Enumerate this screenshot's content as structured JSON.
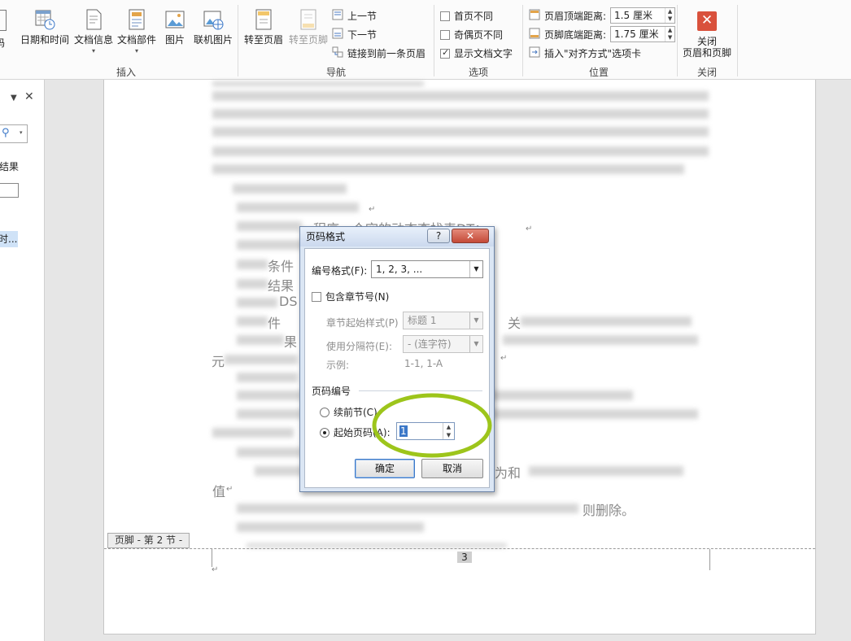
{
  "ribbon": {
    "insert": {
      "label": "插入",
      "date_time": "日期和时间",
      "doc_info": "文档信息",
      "doc_parts": "文档部件",
      "picture": "图片",
      "online_picture": "联机图片",
      "partial_left": "码"
    },
    "navigation": {
      "label": "导航",
      "goto_header": "转至页眉",
      "goto_footer": "转至页脚",
      "prev_section": "上一节",
      "next_section": "下一节",
      "link_prev": "链接到前一条页眉"
    },
    "options": {
      "label": "选项",
      "first_page": "首页不同",
      "odd_even": "奇偶页不同",
      "show_text": "显示文档文字",
      "show_text_checked": true
    },
    "position": {
      "label": "位置",
      "header_top": "页眉顶端距离:",
      "header_top_value": "1.5 厘米",
      "footer_bottom": "页脚底端距离:",
      "footer_bottom_value": "1.75 厘米",
      "insert_align_tab": "插入\"对齐方式\"选项卡"
    },
    "close": {
      "label": "关闭",
      "button_line1": "关闭",
      "button_line2": "页眉和页脚"
    }
  },
  "nav_pane": {
    "results_partial": "结果",
    "item_partial": "时..."
  },
  "document": {
    "visible": [
      "程序一个空的动态查找表DT；",
      "条件",
      "结果",
      "DS",
      "件",
      "果",
      "元",
      "关",
      "为和",
      "值",
      "则删除。"
    ],
    "footer_tag": "页脚 - 第 2 节 -",
    "footer_page_number": "3"
  },
  "dialog": {
    "title": "页码格式",
    "help_icon": "?",
    "format_label": "编号格式(F):",
    "format_value": "1, 2, 3, ...",
    "include_chapter": "包含章节号(N)",
    "chapter_style_label": "章节起始样式(P)",
    "chapter_style_value": "标题 1",
    "separator_label": "使用分隔符(E):",
    "separator_value": "-  (连字符)",
    "example_label": "示例:",
    "example_value": "1-1, 1-A",
    "numbering_header": "页码编号",
    "continue_label": "续前节(C)",
    "start_label": "起始页码(A):",
    "start_value": "1",
    "ok": "确定",
    "cancel": "取消"
  },
  "colors": {
    "highlight": "#9dc51b",
    "close_red": "#d9513c",
    "accent_blue": "#3c78c8"
  }
}
